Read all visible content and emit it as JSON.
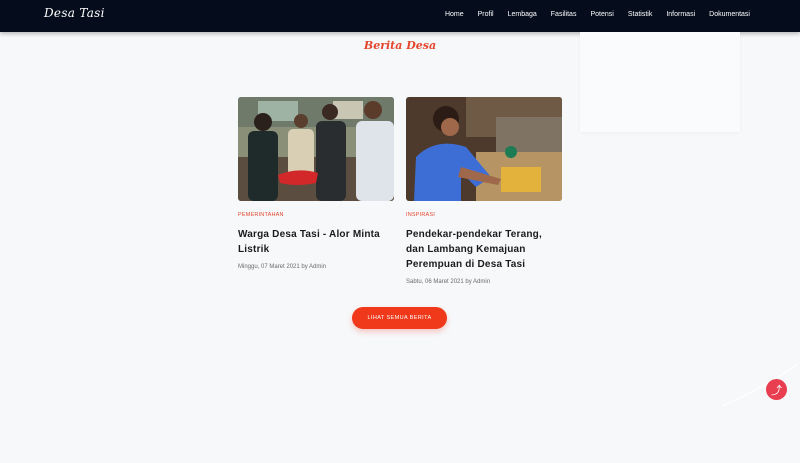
{
  "header": {
    "brand": "Desa Tasi",
    "nav": [
      "Home",
      "Profil",
      "Lembaga",
      "Fasilitas",
      "Potensi",
      "Statistik",
      "Informasi",
      "Dokumentasi"
    ]
  },
  "section": {
    "title": "Berita Desa"
  },
  "articles": [
    {
      "category": "PEMERINTAHAN",
      "title": "Warga Desa Tasi - Alor Minta Listrik",
      "meta": "Minggu, 07 Maret 2021 by Admin"
    },
    {
      "category": "INSPIRASI",
      "title": "Pendekar-pendekar Terang, dan Lambang Kemajuan Perempuan di Desa Tasi",
      "meta": "Sabtu, 06 Maret 2021 by Admin"
    }
  ],
  "buttons": {
    "all_news": "LIHAT SEMUA BERITA",
    "back_to_top": "⤴"
  },
  "colors": {
    "navbar": "#050d1c",
    "accent": "#e3472e",
    "button": "#f0381a",
    "top_button": "#e83e4f"
  },
  "icons": {
    "back_to_top": "arrow-up-icon"
  }
}
